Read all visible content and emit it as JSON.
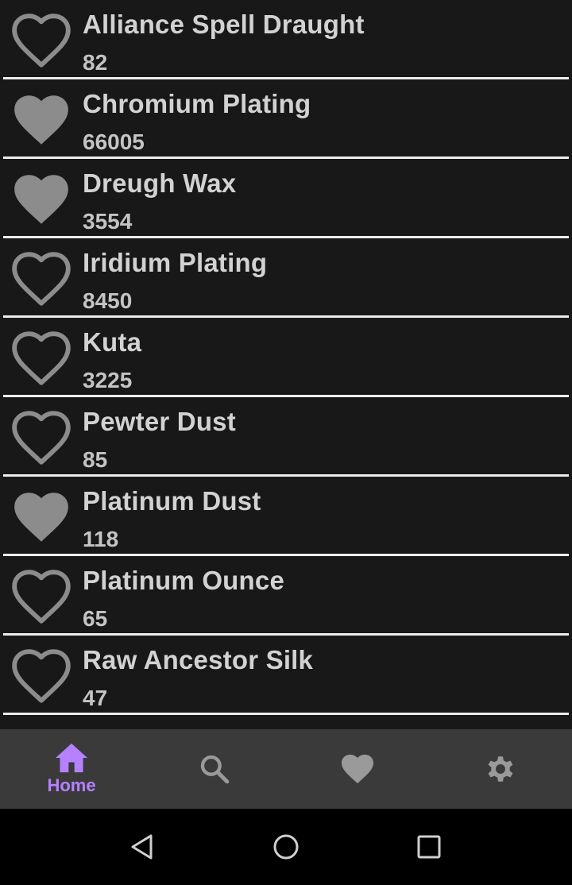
{
  "items": [
    {
      "name": "Alliance Spell Draught",
      "value": "82",
      "favorite": false
    },
    {
      "name": "Chromium Plating",
      "value": "66005",
      "favorite": true
    },
    {
      "name": "Dreugh Wax",
      "value": "3554",
      "favorite": true
    },
    {
      "name": "Iridium Plating",
      "value": "8450",
      "favorite": false
    },
    {
      "name": "Kuta",
      "value": "3225",
      "favorite": false
    },
    {
      "name": "Pewter Dust",
      "value": "85",
      "favorite": false
    },
    {
      "name": "Platinum Dust",
      "value": "118",
      "favorite": true
    },
    {
      "name": "Platinum Ounce",
      "value": "65",
      "favorite": false
    },
    {
      "name": "Raw Ancestor Silk",
      "value": "47",
      "favorite": false
    }
  ],
  "bottom_nav": {
    "home": {
      "label": "Home",
      "icon": "home-icon",
      "active": true
    },
    "search": {
      "icon": "search-icon"
    },
    "favorites": {
      "icon": "heart-icon"
    },
    "settings": {
      "icon": "gear-icon"
    }
  },
  "system_nav": {
    "back": {
      "icon": "back-triangle-icon"
    },
    "home": {
      "icon": "home-circle-icon"
    },
    "recents": {
      "icon": "recents-square-icon"
    }
  },
  "colors": {
    "background": "#181818",
    "divider": "#ececec",
    "heart": "#8c8c8c",
    "text": "#d2d2d2",
    "nav_background": "#3a3a3a",
    "nav_icon": "#9a9a9a",
    "accent": "#b681ff"
  }
}
